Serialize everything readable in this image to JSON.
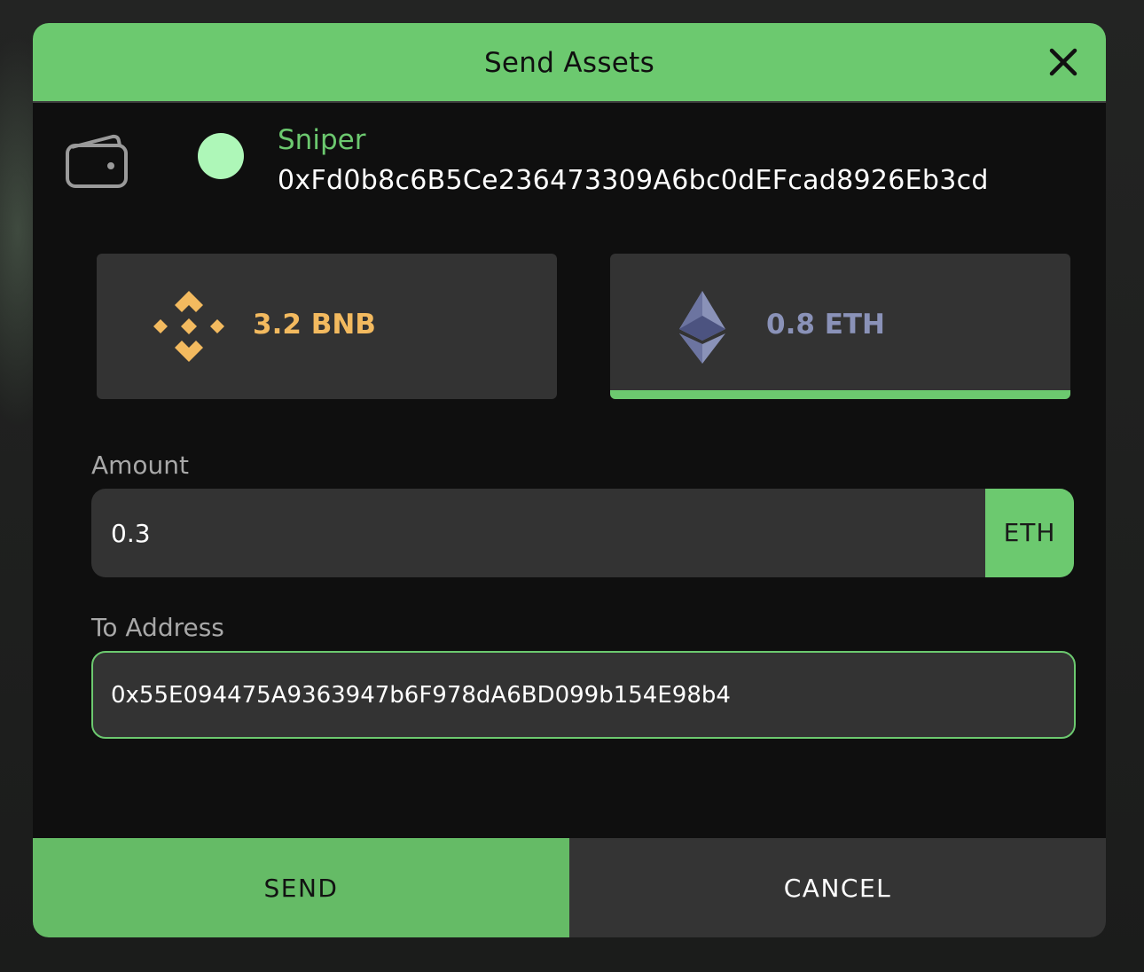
{
  "modal": {
    "title": "Send Assets"
  },
  "account": {
    "name": "Sniper",
    "address": "0xFd0b8c6B5Ce236473309A6bc0dEFcad8926Eb3cd"
  },
  "assets": [
    {
      "balance": "3.2 BNB",
      "icon": "bnb-icon",
      "color": "#f3ba5f",
      "selected": false
    },
    {
      "balance": "0.8 ETH",
      "icon": "eth-icon",
      "color": "#8a92b8",
      "selected": true
    }
  ],
  "form": {
    "amount_label": "Amount",
    "amount_value": "0.3",
    "amount_unit": "ETH",
    "to_label": "To Address",
    "to_value": "0x55E094475A9363947b6F978dA6BD099b154E98b4"
  },
  "buttons": {
    "send": "SEND",
    "cancel": "CANCEL"
  },
  "colors": {
    "accent": "#6cc96f",
    "surface": "#333333",
    "background": "#0f0f0f"
  }
}
